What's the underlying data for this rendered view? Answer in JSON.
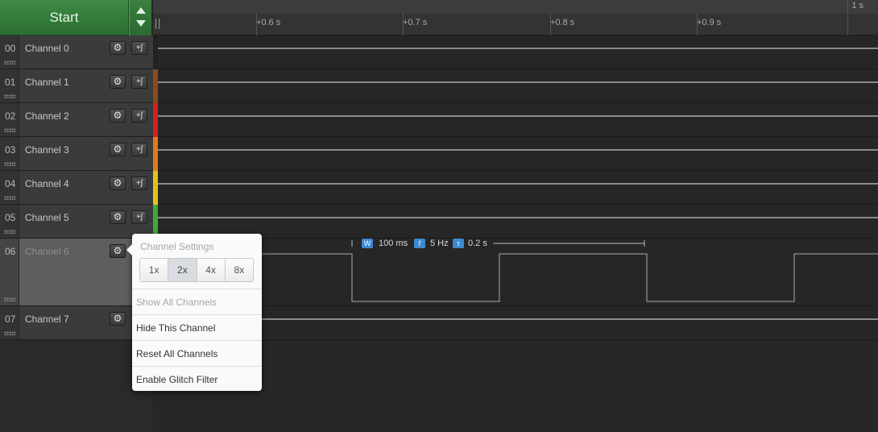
{
  "header": {
    "start_label": "Start"
  },
  "ruler": {
    "ticks": [
      "+0.6 s",
      "+0.7 s",
      "+0.8 s",
      "+0.9 s"
    ],
    "end_label": "1 s"
  },
  "channels": [
    {
      "num": "00",
      "name": "Channel 0",
      "color": "#222222"
    },
    {
      "num": "01",
      "name": "Channel 1",
      "color": "#8b4a1a"
    },
    {
      "num": "02",
      "name": "Channel 2",
      "color": "#d32020"
    },
    {
      "num": "03",
      "name": "Channel 3",
      "color": "#e07a1a"
    },
    {
      "num": "04",
      "name": "Channel 4",
      "color": "#e3c21c"
    },
    {
      "num": "05",
      "name": "Channel 5",
      "color": "#3fa83a"
    },
    {
      "num": "06",
      "name": "Channel 6",
      "color": "#2f6bd0"
    },
    {
      "num": "07",
      "name": "Channel 7",
      "color": "#8a4bc0"
    }
  ],
  "icons": {
    "gear": "gear-icon",
    "trigger": "trigger-icon"
  },
  "measurement": {
    "width": "100 ms",
    "frequency": "5 Hz",
    "period": "0.2 s",
    "width_badge": "W",
    "freq_badge": "f",
    "period_badge": "τ"
  },
  "popup": {
    "title": "Channel Settings",
    "zoom_options": [
      "1x",
      "2x",
      "4x",
      "8x"
    ],
    "zoom_selected": "2x",
    "items": [
      {
        "label": "Show All Channels",
        "enabled": false
      },
      {
        "label": "Hide This Channel",
        "enabled": true
      },
      {
        "label": "Reset All Channels",
        "enabled": true
      },
      {
        "label": "Enable Glitch Filter",
        "enabled": true
      }
    ]
  }
}
